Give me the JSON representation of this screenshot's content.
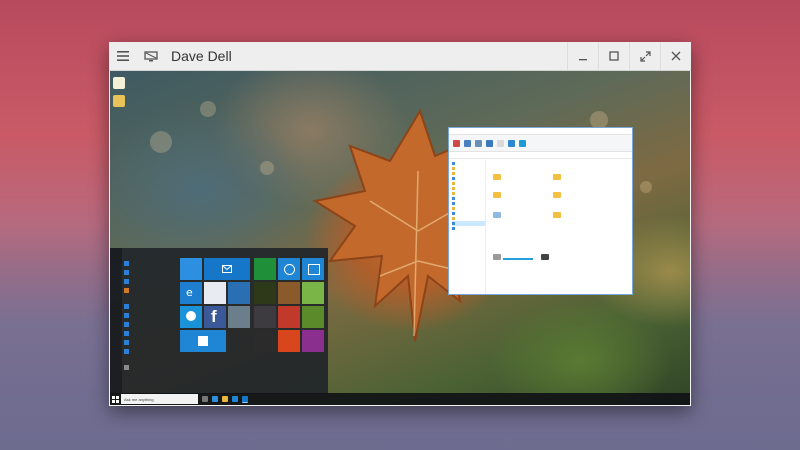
{
  "window": {
    "title": "Dave Dell",
    "menu_icon": "hamburger-menu-icon",
    "display_icon": "remote-display-icon",
    "controls": [
      "minimize-icon",
      "maximize-icon",
      "fullscreen-icon",
      "close-icon"
    ]
  },
  "remote_desktop": {
    "taskbar": {
      "search_placeholder": "Ask me anything"
    }
  }
}
